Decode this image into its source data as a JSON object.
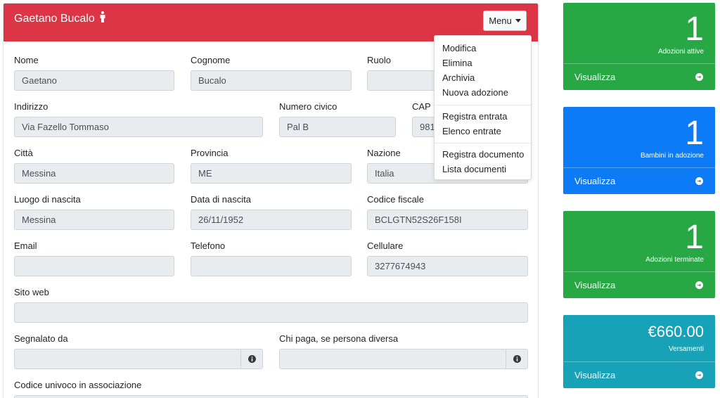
{
  "header": {
    "title": "Gaetano Bucalo",
    "menu_label": "Menu"
  },
  "menu": {
    "items": [
      "Modifica",
      "Elimina",
      "Archivia",
      "Nuova adozione",
      "Registra entrata",
      "Elenco entrate",
      "Registra documento",
      "Lista documenti"
    ]
  },
  "form": {
    "nome": {
      "label": "Nome",
      "value": "Gaetano"
    },
    "cognome": {
      "label": "Cognome",
      "value": "Bucalo"
    },
    "ruolo": {
      "label": "Ruolo",
      "value": ""
    },
    "indirizzo": {
      "label": "Indirizzo",
      "value": "Via Fazello Tommaso"
    },
    "numero_civico": {
      "label": "Numero civico",
      "value": "Pal B"
    },
    "cap": {
      "label": "CAP",
      "value": "981"
    },
    "citta": {
      "label": "Città",
      "value": "Messina"
    },
    "provincia": {
      "label": "Provincia",
      "value": "ME"
    },
    "nazione": {
      "label": "Nazione",
      "value": "Italia"
    },
    "luogo_nascita": {
      "label": "Luogo di nascita",
      "value": "Messina"
    },
    "data_nascita": {
      "label": "Data di nascita",
      "value": "26/11/1952"
    },
    "codice_fiscale": {
      "label": "Codice fiscale",
      "value": "BCLGTN52S26F158I"
    },
    "email": {
      "label": "Email",
      "value": ""
    },
    "telefono": {
      "label": "Telefono",
      "value": ""
    },
    "cellulare": {
      "label": "Cellulare",
      "value": "3277674943"
    },
    "sito_web": {
      "label": "Sito web",
      "value": ""
    },
    "segnalato_da": {
      "label": "Segnalato da",
      "value": ""
    },
    "chi_paga": {
      "label": "Chi paga, se persona diversa",
      "value": ""
    },
    "codice_univoco": {
      "label": "Codice univoco in associazione",
      "value": ""
    }
  },
  "stats": [
    {
      "value": "1",
      "label": "Adozioni attive",
      "link": "Visualizza",
      "color": "#28a745"
    },
    {
      "value": "1",
      "label": "Bambini in adozione",
      "link": "Visualizza",
      "color": "#0d7bf5"
    },
    {
      "value": "1",
      "label": "Adozioni terminate",
      "link": "Visualizza",
      "color": "#28a745"
    },
    {
      "value": "€660.00",
      "label": "Versamenti",
      "link": "Visualizza",
      "color": "#17a2b8"
    }
  ],
  "colors": {
    "header": "#dc3545",
    "field_bg": "#e9ecef",
    "field_border": "#ced4da"
  },
  "icons": {
    "title": "male-person-icon",
    "info": "info-circle-icon",
    "arrow": "arrow-circle-right-icon"
  }
}
